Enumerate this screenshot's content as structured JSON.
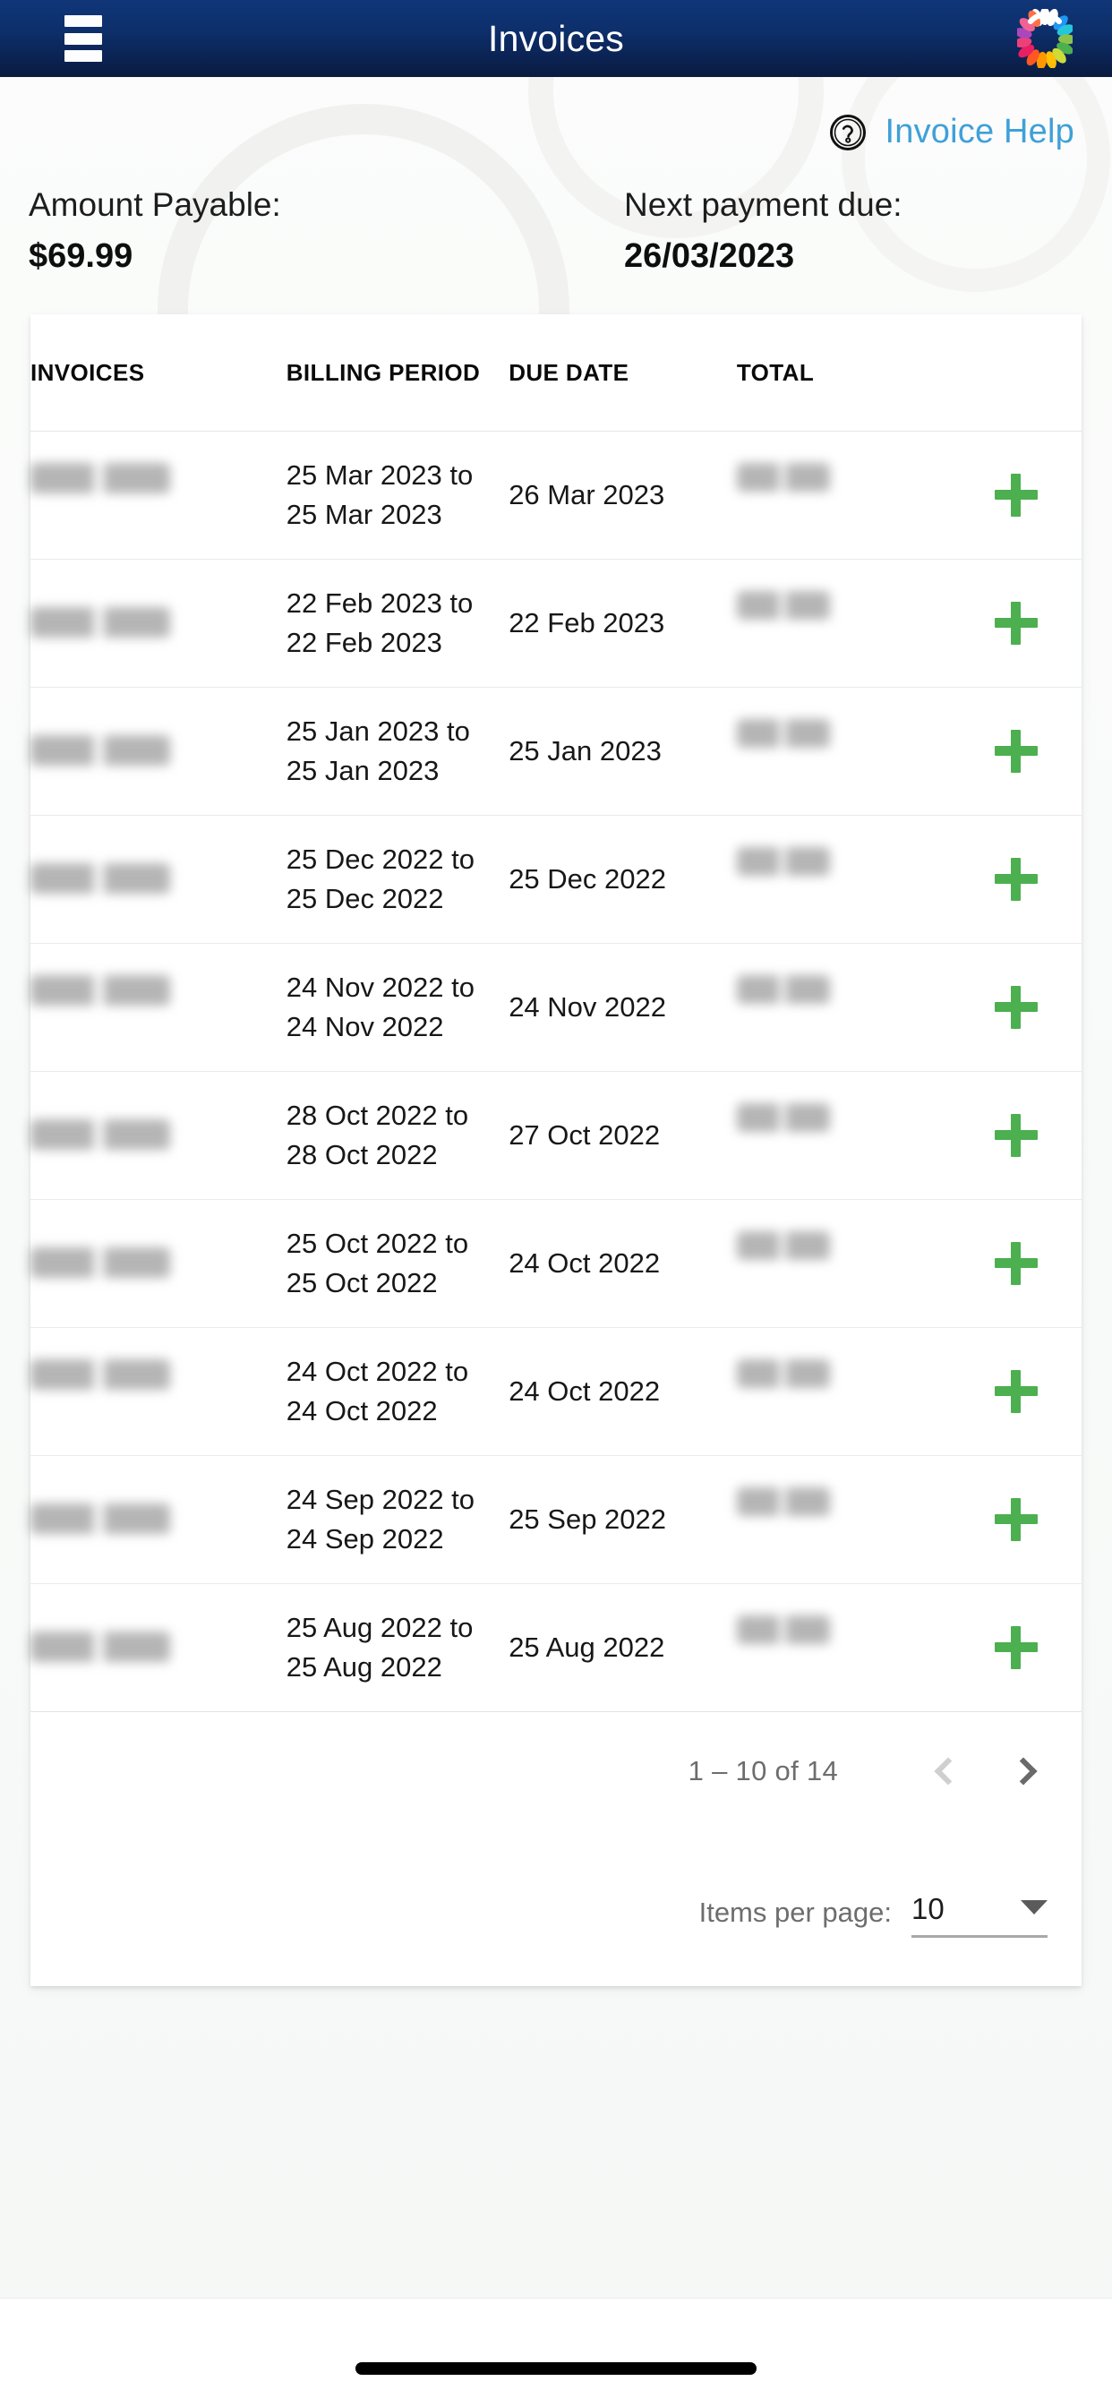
{
  "header": {
    "title": "Invoices",
    "menu_icon": "hamburger-menu-icon",
    "logo_icon": "brand-petal-ring-logo"
  },
  "help": {
    "icon": "question-mark-circle-icon",
    "label": "Invoice Help"
  },
  "summary": {
    "amount_label": "Amount Payable:",
    "amount_value": "$69.99",
    "due_label": "Next payment due:",
    "due_value": "26/03/2023"
  },
  "table": {
    "columns": [
      "INVOICES",
      "BILLING PERIOD",
      "DUE DATE",
      "TOTAL",
      ""
    ],
    "rows": [
      {
        "invoice": "██ ██████",
        "billing_period": "25 Mar 2023 to 25 Mar 2023",
        "due_date": "26 Mar 2023",
        "total": "███ ██",
        "action_icon": "plus-icon"
      },
      {
        "invoice": "████████",
        "billing_period": "22 Feb 2023 to 22 Feb 2023",
        "due_date": "22 Feb 2023",
        "total": "███ ██",
        "action_icon": "plus-icon"
      },
      {
        "invoice": "███████",
        "billing_period": "25 Jan 2023 to 25 Jan 2023",
        "due_date": "25 Jan 2023",
        "total": "███ ██",
        "action_icon": "plus-icon"
      },
      {
        "invoice": "████████",
        "billing_period": "25 Dec 2022 to 25 Dec 2022",
        "due_date": "25 Dec 2022",
        "total": "███ ██",
        "action_icon": "plus-icon"
      },
      {
        "invoice": "██ █████",
        "billing_period": "24 Nov 2022 to 24 Nov 2022",
        "due_date": "24 Nov 2022",
        "total": "███ ██",
        "action_icon": "plus-icon"
      },
      {
        "invoice": "███████",
        "billing_period": "28 Oct 2022 to 28 Oct 2022",
        "due_date": "27 Oct 2022",
        "total": "███ ██",
        "action_icon": "plus-icon"
      },
      {
        "invoice": "████████",
        "billing_period": "25 Oct 2022 to 25 Oct 2022",
        "due_date": "24 Oct 2022",
        "total": "███ ██",
        "action_icon": "plus-icon"
      },
      {
        "invoice": "██████ █",
        "billing_period": "24 Oct 2022 to 24 Oct 2022",
        "due_date": "24 Oct 2022",
        "total": "███ ██",
        "action_icon": "plus-icon"
      },
      {
        "invoice": "███████",
        "billing_period": "24 Sep 2022 to 24 Sep 2022",
        "due_date": "25 Sep 2022",
        "total": "███ ██",
        "action_icon": "plus-icon"
      },
      {
        "invoice": "████████",
        "billing_period": "25 Aug 2022 to 25 Aug 2022",
        "due_date": "25 Aug 2022",
        "total": "███ ██",
        "action_icon": "plus-icon"
      }
    ]
  },
  "paginator": {
    "range_label": "1 – 10 of 14",
    "prev_icon": "chevron-left-icon",
    "next_icon": "chevron-right-icon",
    "items_per_page_label": "Items per page:",
    "items_per_page_value": "10",
    "caret_icon": "chevron-down-icon"
  },
  "colors": {
    "header_gradient_top": "#103678",
    "header_gradient_bottom": "#0a1c3f",
    "link_blue": "#3fa0d8",
    "plus_green": "#4caf50",
    "muted_text": "#6d6d6d"
  }
}
